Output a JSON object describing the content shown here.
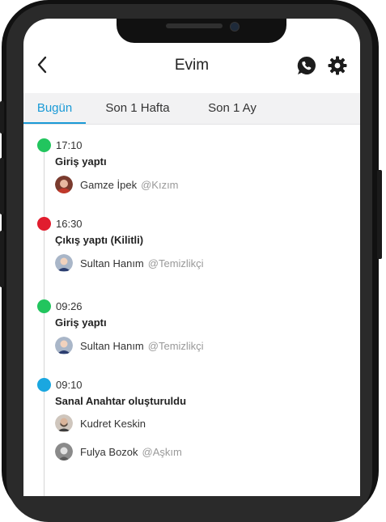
{
  "header": {
    "title": "Evim",
    "back_icon": "chevron-left-icon",
    "whatsapp_icon": "whatsapp-icon",
    "settings_icon": "gear-icon"
  },
  "tabs": [
    {
      "label": "Bugün",
      "active": true
    },
    {
      "label": "Son 1 Hafta",
      "active": false
    },
    {
      "label": "Son 1 Ay",
      "active": false
    }
  ],
  "colors": {
    "accent": "#1a9ad6",
    "green": "#22c55e",
    "red": "#e11d2e",
    "blue": "#1aa7e0"
  },
  "events": [
    {
      "time": "17:10",
      "status": "green",
      "title": "Giriş yaptı",
      "users": [
        {
          "name": "Gamze İpek",
          "handle": "@Kızım"
        }
      ]
    },
    {
      "time": "16:30",
      "status": "red",
      "title": "Çıkış yaptı (Kilitli)",
      "users": [
        {
          "name": "Sultan Hanım",
          "handle": "@Temizlikçi"
        }
      ]
    },
    {
      "time": "09:26",
      "status": "green",
      "title": "Giriş yaptı",
      "users": [
        {
          "name": "Sultan Hanım",
          "handle": "@Temizlikçi"
        }
      ]
    },
    {
      "time": "09:10",
      "status": "blue",
      "title": "Sanal Anahtar oluşturuldu",
      "users": [
        {
          "name": "Kudret Keskin",
          "handle": ""
        },
        {
          "name": "Fulya Bozok",
          "handle": "@Aşkım"
        }
      ]
    }
  ]
}
